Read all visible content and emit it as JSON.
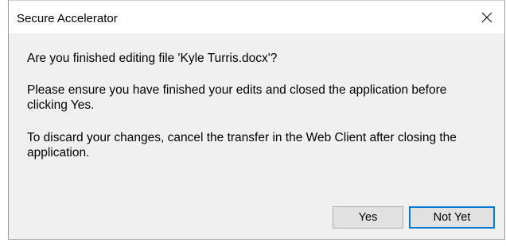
{
  "window": {
    "title": "Secure Accelerator",
    "close_icon": "close-icon"
  },
  "message": {
    "line1": "Are you finished editing file 'Kyle Turris.docx'?",
    "line2": "Please ensure you have finished your edits and closed the application before clicking Yes.",
    "line3": "To discard your changes, cancel the transfer in the Web Client after closing the application."
  },
  "buttons": {
    "yes_label": "Yes",
    "not_yet_label": "Not Yet"
  },
  "colors": {
    "title_bg": "#ffffff",
    "body_bg": "#f0f0f0",
    "button_bg": "#e1e1e1",
    "focus_border": "#0078d7"
  }
}
